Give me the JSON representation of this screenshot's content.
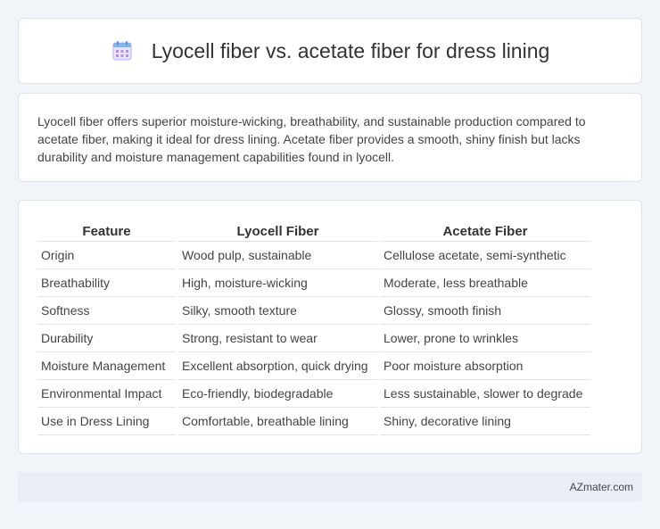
{
  "header": {
    "icon": "calendar-icon",
    "title": "Lyocell fiber vs. acetate fiber for dress lining"
  },
  "summary": "Lyocell fiber offers superior moisture-wicking, breathability, and sustainable production compared to acetate fiber, making it ideal for dress lining. Acetate fiber provides a smooth, shiny finish but lacks durability and moisture management capabilities found in lyocell.",
  "table": {
    "headers": [
      "Feature",
      "Lyocell Fiber",
      "Acetate Fiber"
    ],
    "rows": [
      [
        "Origin",
        "Wood pulp, sustainable",
        "Cellulose acetate, semi-synthetic"
      ],
      [
        "Breathability",
        "High, moisture-wicking",
        "Moderate, less breathable"
      ],
      [
        "Softness",
        "Silky, smooth texture",
        "Glossy, smooth finish"
      ],
      [
        "Durability",
        "Strong, resistant to wear",
        "Lower, prone to wrinkles"
      ],
      [
        "Moisture Management",
        "Excellent absorption, quick drying",
        "Poor moisture absorption"
      ],
      [
        "Environmental Impact",
        "Eco-friendly, biodegradable",
        "Less sustainable, slower to degrade"
      ],
      [
        "Use in Dress Lining",
        "Comfortable, breathable lining",
        "Shiny, decorative lining"
      ]
    ]
  },
  "footer": {
    "site": "AZmater.com"
  },
  "colors": {
    "background": "#f1f4f9",
    "card": "#ffffff",
    "footer": "#e8edf6",
    "icon_accent": "#8a7be0"
  }
}
